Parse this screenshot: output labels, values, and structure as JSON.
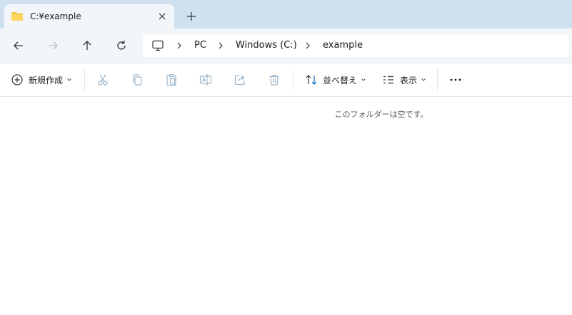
{
  "tab": {
    "title": "C:¥example",
    "close_icon": "close-icon",
    "folder_icon": "folder-icon"
  },
  "navigation": {
    "back_icon": "arrow-left-icon",
    "forward_icon": "arrow-right-icon",
    "up_icon": "arrow-up-icon",
    "refresh_icon": "refresh-icon",
    "breadcrumb": [
      "PC",
      "Windows (C:)",
      "example"
    ]
  },
  "commands": {
    "new_label": "新規作成",
    "sort_label": "並べ替え",
    "view_label": "表示",
    "icons": [
      "cut-icon",
      "copy-icon",
      "paste-icon",
      "rename-icon",
      "share-icon",
      "delete-icon",
      "more-icon"
    ]
  },
  "content": {
    "empty_message": "このフォルダーは空です。"
  },
  "colors": {
    "tabstrip": "#cfe0ee",
    "navbar": "#f3f6f9",
    "folder": "#f2c94c",
    "accent": "#0f6cbd"
  }
}
